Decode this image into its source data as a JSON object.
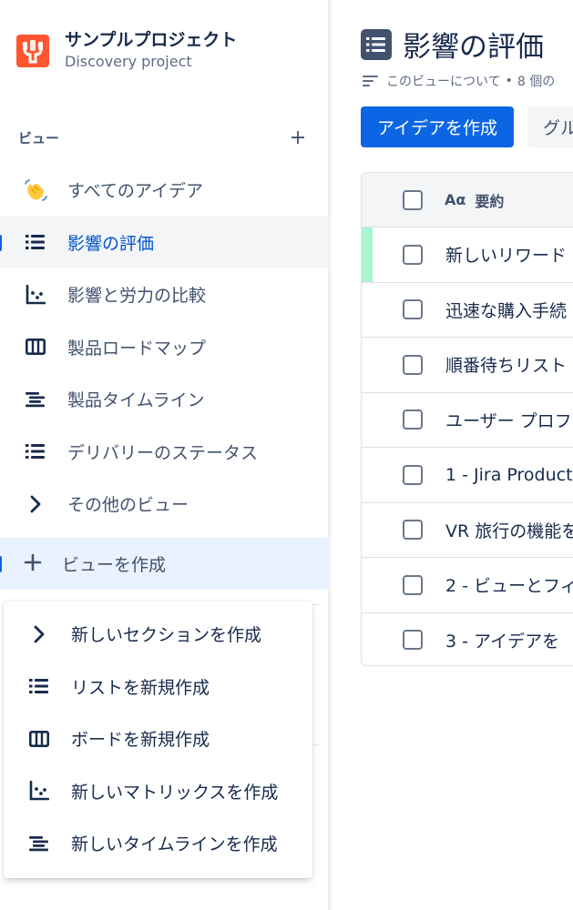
{
  "project": {
    "name": "サンプルプロジェクト",
    "type": "Discovery project",
    "avatar_color": "#ff5630"
  },
  "sidebar": {
    "views_heading": "ビュー",
    "add_label": "+",
    "items": [
      {
        "label": "すべてのアイデア",
        "icon": "waving-hands-icon",
        "selected": false
      },
      {
        "label": "影響の評価",
        "icon": "list-icon",
        "selected": true
      },
      {
        "label": "影響と労力の比較",
        "icon": "matrix-icon",
        "selected": false
      },
      {
        "label": "製品ロードマップ",
        "icon": "board-icon",
        "selected": false
      },
      {
        "label": "製品タイムライン",
        "icon": "timeline-icon",
        "selected": false
      },
      {
        "label": "デリバリーのステータス",
        "icon": "list-icon",
        "selected": false
      },
      {
        "label": "その他のビュー",
        "icon": "chevron-right-icon",
        "selected": false
      }
    ],
    "create_view_label": "ビューを作成"
  },
  "create_menu": {
    "items": [
      {
        "label": "新しいセクションを作成",
        "icon": "chevron-right-icon"
      },
      {
        "label": "リストを新規作成",
        "icon": "list-icon"
      },
      {
        "label": "ボードを新規作成",
        "icon": "board-icon"
      },
      {
        "label": "新しいマトリックスを作成",
        "icon": "matrix-icon"
      },
      {
        "label": "新しいタイムラインを作成",
        "icon": "timeline-icon"
      }
    ]
  },
  "main": {
    "title": "影響の評価",
    "about_label": "このビューについて",
    "about_separator": "•",
    "about_count": "8 個の",
    "create_idea_button": "アイデアを作成",
    "group_button": "グル",
    "table": {
      "header_icon": "Aα",
      "header_label": "要約",
      "rows": [
        {
          "summary": "新しいリワード",
          "accent": true
        },
        {
          "summary": "迅速な購入手続",
          "accent": false
        },
        {
          "summary": "順番待ちリスト",
          "accent": false
        },
        {
          "summary": "ユーザー プロフ",
          "accent": false
        },
        {
          "summary": "1 - Jira Product",
          "accent": false
        },
        {
          "summary": "VR 旅行の機能を",
          "accent": false
        },
        {
          "summary": "2 - ビューとフィ",
          "accent": false
        },
        {
          "summary": "3 - アイデアを ",
          "accent": false
        }
      ]
    }
  },
  "colors": {
    "primary": "#0c66e4",
    "selected_text": "#0052cc",
    "selected_bg": "#f4f5f7",
    "create_bg": "#e9f2ff",
    "row_accent": "#abf5d1"
  }
}
